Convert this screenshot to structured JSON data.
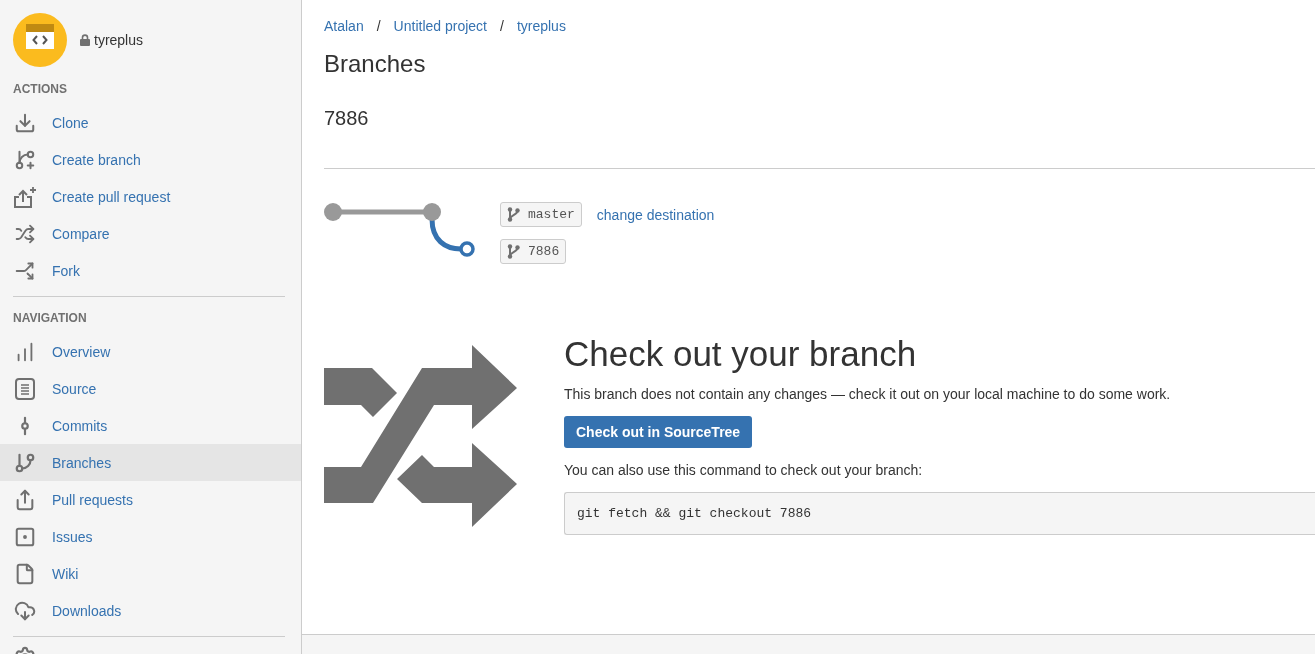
{
  "repository": {
    "name": "tyreplus",
    "private": true
  },
  "sidebar": {
    "sections": [
      {
        "heading": "ACTIONS",
        "items": [
          {
            "label": "Clone",
            "kind": "clone"
          },
          {
            "label": "Create branch",
            "kind": "branchadd"
          },
          {
            "label": "Create pull request",
            "kind": "pulladd"
          },
          {
            "label": "Compare",
            "kind": "compare"
          },
          {
            "label": "Fork",
            "kind": "fork"
          }
        ]
      },
      {
        "heading": "NAVIGATION",
        "items": [
          {
            "label": "Overview",
            "kind": "overview",
            "selected": false
          },
          {
            "label": "Source",
            "kind": "source",
            "selected": false
          },
          {
            "label": "Commits",
            "kind": "commits",
            "selected": false
          },
          {
            "label": "Branches",
            "kind": "branches",
            "selected": true
          },
          {
            "label": "Pull requests",
            "kind": "pullrequests",
            "selected": false
          },
          {
            "label": "Issues",
            "kind": "issues",
            "selected": false
          },
          {
            "label": "Wiki",
            "kind": "wiki",
            "selected": false
          },
          {
            "label": "Downloads",
            "kind": "downloads",
            "selected": false
          }
        ]
      }
    ]
  },
  "breadcrumbs": [
    {
      "label": "Atalan",
      "separator": "/"
    },
    {
      "label": "Untitled project",
      "separator": "/"
    },
    {
      "label": "tyreplus"
    }
  ],
  "page_title": "Branches",
  "branch_name": "7886",
  "comparison": {
    "destination": {
      "branch": "master",
      "link": "change destination"
    },
    "source": {
      "branch": "7886"
    }
  },
  "checkout": {
    "heading": "Check out your branch",
    "description": "This branch does not contain any changes — check it out on your local machine to do some work.",
    "button": "Check out in SourceTree",
    "command_hint": "You can also use this command to check out your branch:",
    "command": "git fetch && git checkout 7886"
  }
}
